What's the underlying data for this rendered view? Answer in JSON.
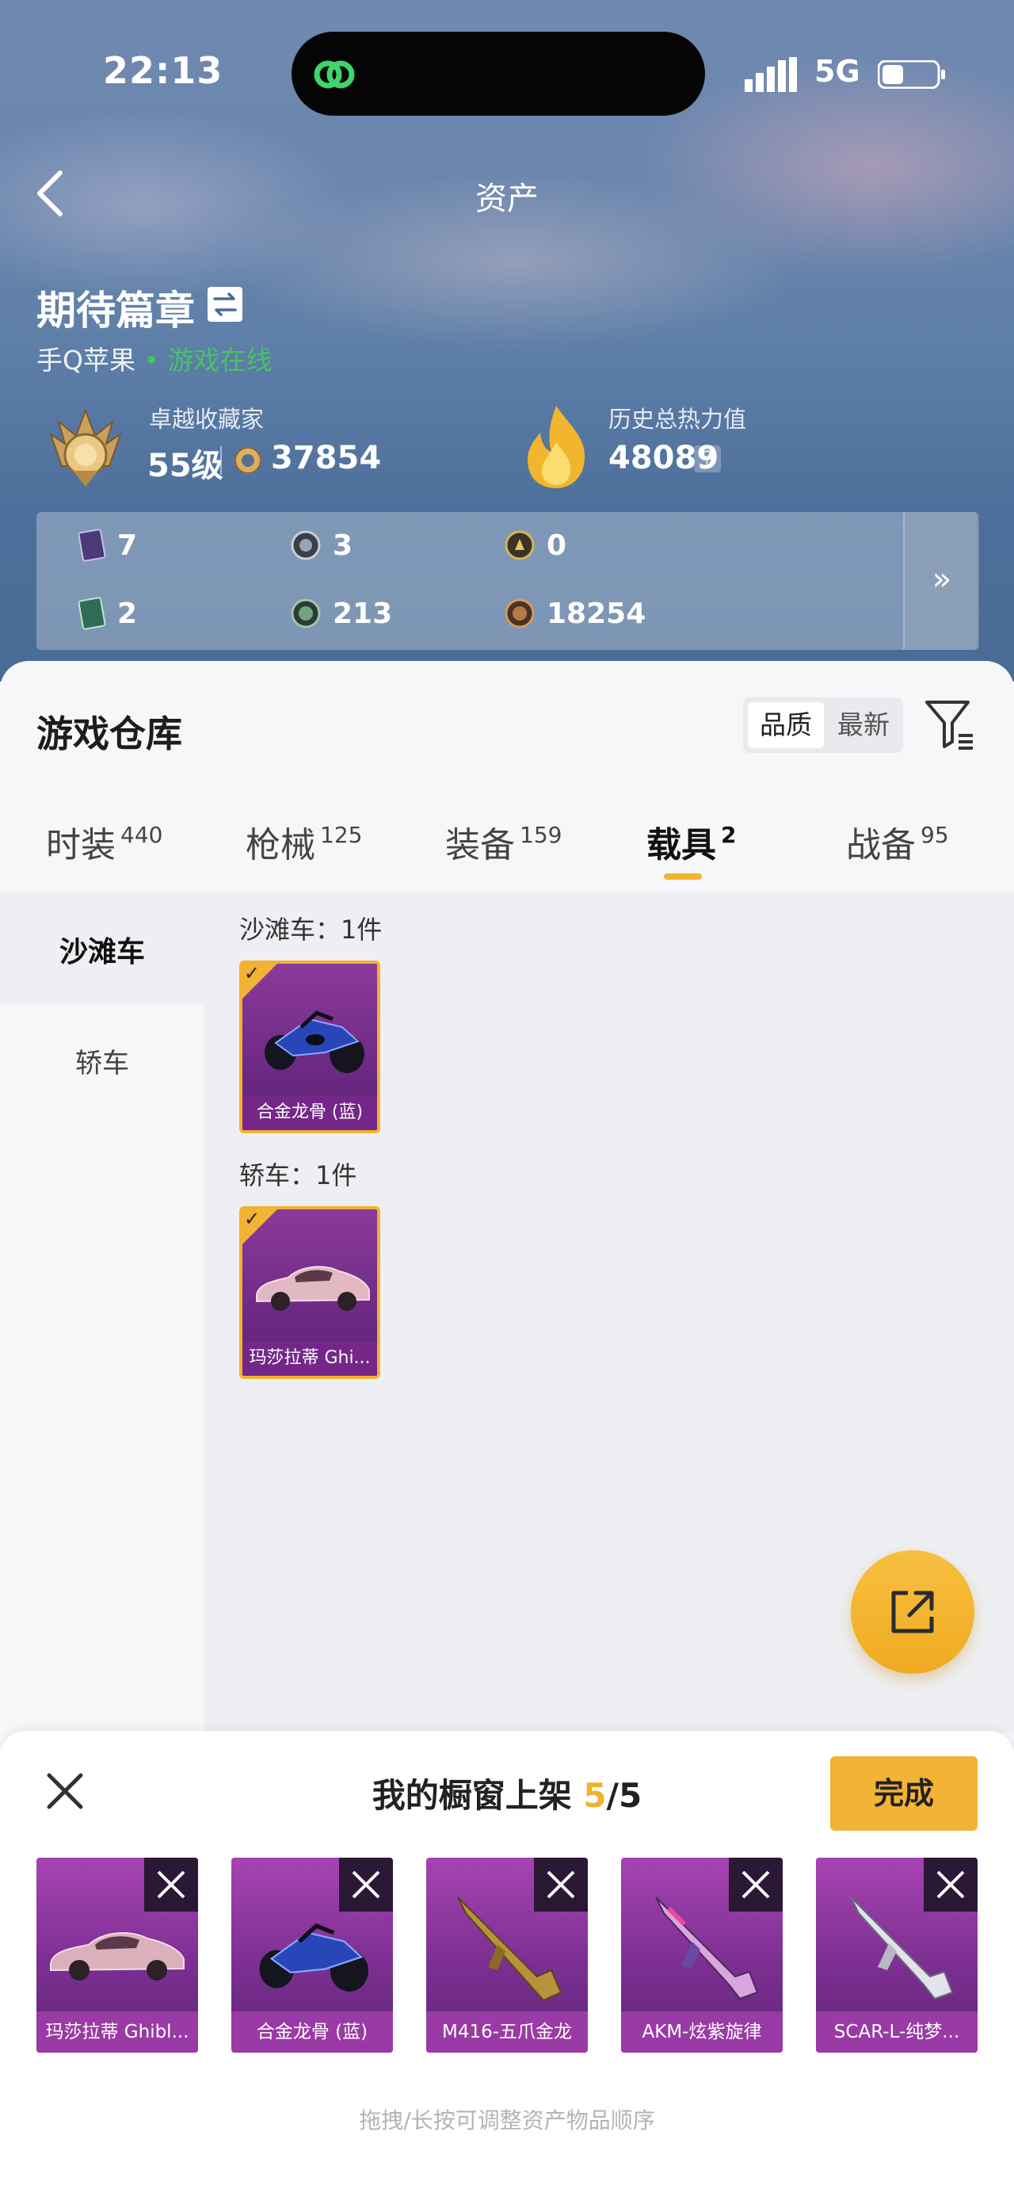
{
  "status_bar": {
    "time": "22:13",
    "network": "5G"
  },
  "header": {
    "title": "资产"
  },
  "profile": {
    "name": "期待篇章",
    "platform": "手Q苹果",
    "online_status": "• 游戏在线",
    "collector_title": "卓越收藏家",
    "collector_level": "55级",
    "collector_points": "37854",
    "heat_title": "历史总热力值",
    "heat_value": "48089",
    "help": "?"
  },
  "stats": {
    "row1": [
      "7",
      "3",
      "0"
    ],
    "row2": [
      "2",
      "213",
      "18254"
    ],
    "more": "»"
  },
  "warehouse": {
    "title": "游戏仓库",
    "sort_quality": "品质",
    "sort_newest": "最新",
    "tabs": [
      {
        "label": "时装",
        "count": "440"
      },
      {
        "label": "枪械",
        "count": "125"
      },
      {
        "label": "装备",
        "count": "159"
      },
      {
        "label": "载具",
        "count": "2"
      },
      {
        "label": "战备",
        "count": "95"
      }
    ],
    "active_tab": "载具",
    "categories": [
      "沙滩车",
      "轿车"
    ],
    "sections": [
      {
        "label": "沙滩车：1件",
        "item": "合金龙骨 (蓝)"
      },
      {
        "label": "轿车：1件",
        "item": "玛莎拉蒂 Ghi..."
      }
    ]
  },
  "showcase": {
    "title_prefix": "我的橱窗上架 ",
    "count_current": "5",
    "count_total": "/5",
    "done_label": "完成",
    "items": [
      "玛莎拉蒂 Ghibl...",
      "合金龙骨 (蓝)",
      "M416-五爪金龙",
      "AKM-炫紫旋律",
      "SCAR-L-纯梦..."
    ],
    "hint": "拖拽/长按可调整资产物品顺序"
  },
  "colors": {
    "accent": "#f3b334",
    "online": "#47c266",
    "card_purple": "#7c2f92"
  }
}
